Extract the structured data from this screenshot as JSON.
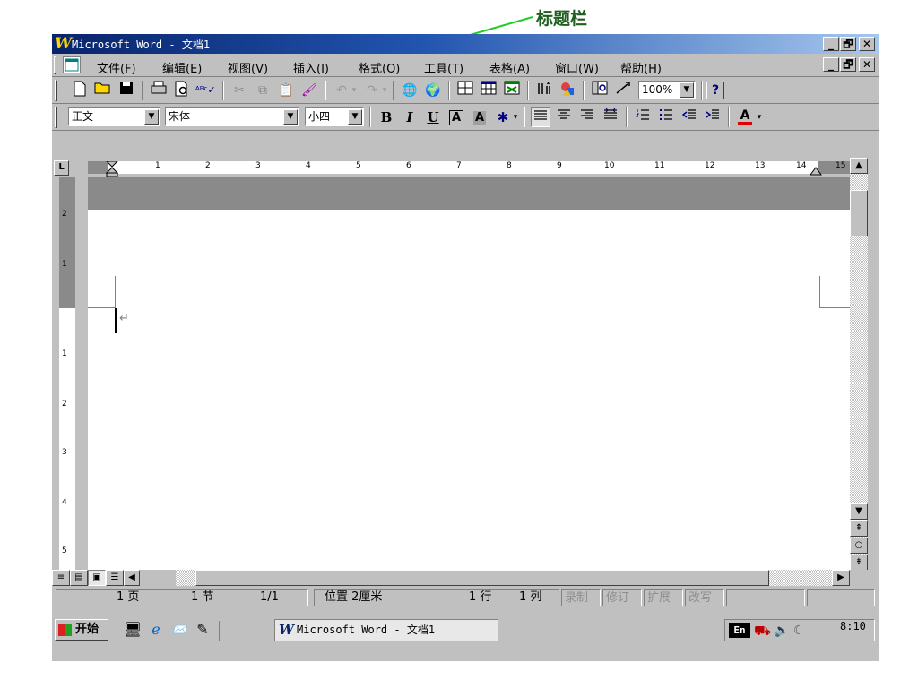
{
  "annotation": {
    "label": "标题栏"
  },
  "window": {
    "logo_letter": "W",
    "title": "Microsoft Word - 文档1",
    "caption_buttons": [
      "_",
      "🗗",
      "✕"
    ]
  },
  "menubar": {
    "items": [
      "文件(F)",
      "编辑(E)",
      "视图(V)",
      "插入(I)",
      "格式(O)",
      "工具(T)",
      "表格(A)",
      "窗口(W)",
      "帮助(H)"
    ]
  },
  "standard_toolbar": {
    "zoom": "100%",
    "help_glyph": "?"
  },
  "formatting_toolbar": {
    "style": "正文",
    "font": "宋体",
    "size": "小四",
    "bold": "B",
    "italic": "I",
    "underline": "U",
    "char_border": "A",
    "char_shading": "A",
    "font_color": "A"
  },
  "ruler": {
    "tab_selector": "L",
    "numbers": [
      "1",
      "2",
      "3",
      "4",
      "5",
      "6",
      "7",
      "8",
      "9",
      "10",
      "11",
      "12",
      "13",
      "14",
      "15"
    ],
    "vertical_numbers": [
      "2",
      "1",
      "1",
      "2",
      "3",
      "4",
      "5"
    ]
  },
  "document": {
    "paragraph_mark": "↵"
  },
  "statusbar": {
    "page": "1 页",
    "section": "1 节",
    "page_of": "1/1",
    "position": "位置 2厘米",
    "line": "1 行",
    "column": "1 列",
    "rec": "录制",
    "trk": "修订",
    "ext": "扩展",
    "ovr": "改写"
  },
  "taskbar": {
    "start": "开始",
    "task_title": "Microsoft Word - 文档1",
    "input_indicator": "En",
    "clock": "8:10"
  }
}
